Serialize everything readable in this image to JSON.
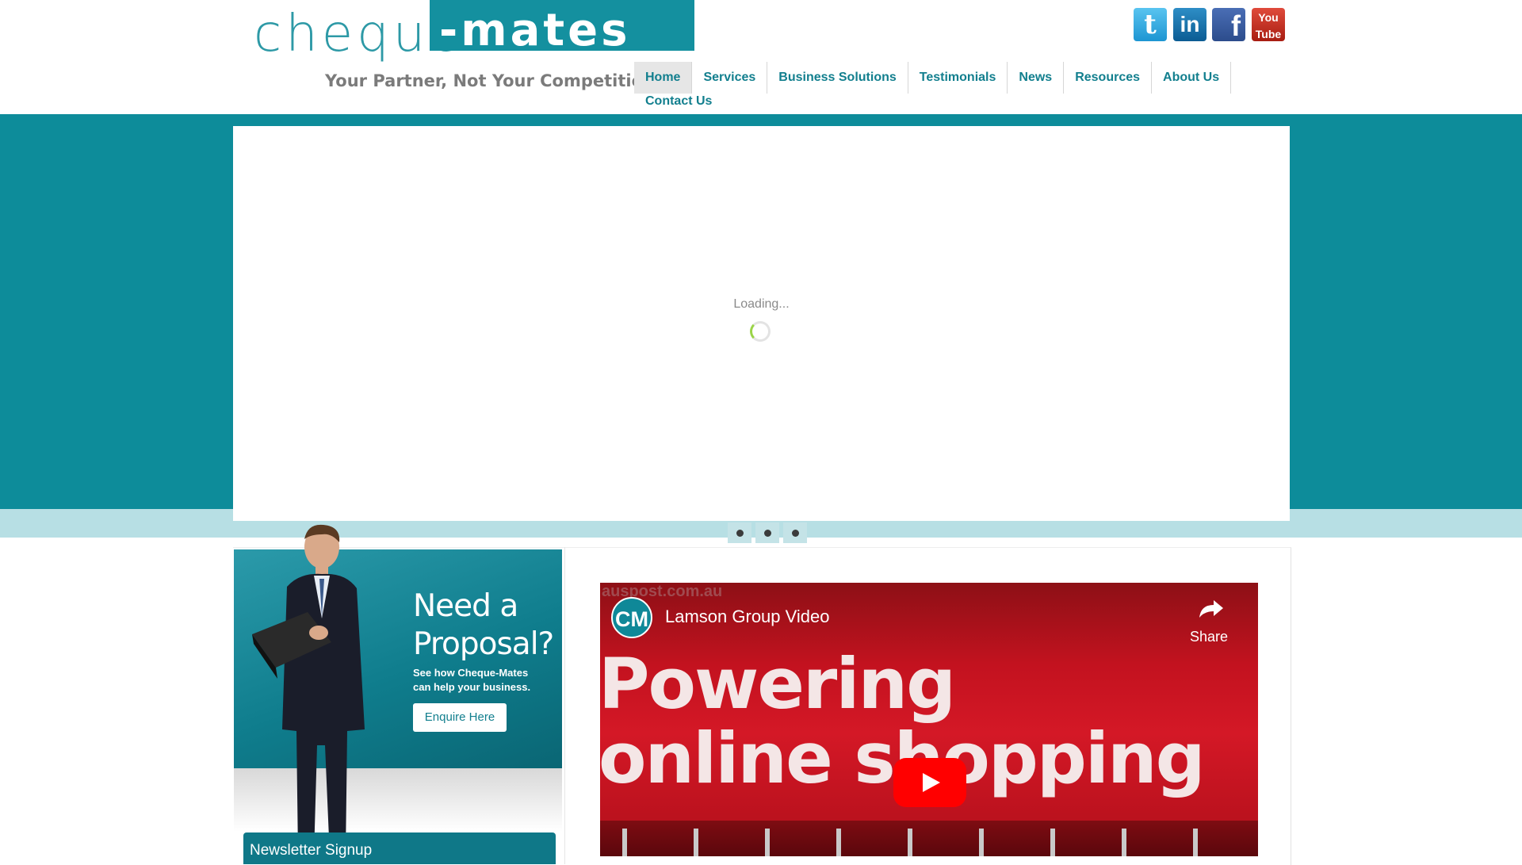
{
  "brand": {
    "logo_part1": "cheque",
    "logo_part2": "-mates",
    "tagline": "Your Partner, Not Your Competition",
    "primary_color": "#0d8c9a",
    "light_color": "#b7dfe4"
  },
  "social": {
    "twitter": "t",
    "linkedin": "in",
    "facebook": "f",
    "youtube_line1": "You",
    "youtube_line2": "Tube"
  },
  "nav": {
    "items": [
      {
        "label": "Home",
        "active": true
      },
      {
        "label": "Services"
      },
      {
        "label": "Business Solutions"
      },
      {
        "label": "Testimonials"
      },
      {
        "label": "News"
      },
      {
        "label": "Resources"
      },
      {
        "label": "About Us"
      },
      {
        "label": "Contact Us"
      }
    ]
  },
  "slider": {
    "loading_text": "Loading...",
    "dots": 3
  },
  "promo": {
    "heading_line1": "Need a",
    "heading_line2": "Proposal?",
    "subtext": "See how Cheque-Mates can help your business.",
    "button_label": "Enquire Here"
  },
  "newsletter": {
    "title": "Newsletter Signup"
  },
  "video": {
    "watermark": "auspost.com.au",
    "channel_initials": "CM",
    "title": "Lamson Group Video",
    "share_label": "Share",
    "headline_line1": "Powering",
    "headline_line2": "online shopping"
  }
}
